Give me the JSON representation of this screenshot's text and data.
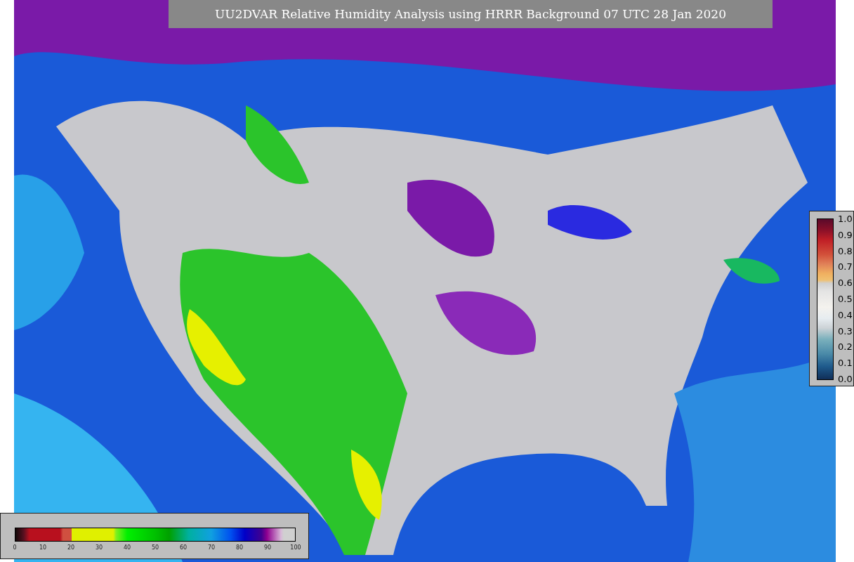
{
  "title": "UU2DVAR Relative Humidity Analysis using HRRR Background 07 UTC 28 Jan 2020",
  "colorbar_bottom": {
    "ticks": [
      "0",
      "10",
      "20",
      "30",
      "40",
      "50",
      "60",
      "70",
      "80",
      "90",
      "100"
    ]
  },
  "colorbar_right": {
    "ticks": [
      "1.0",
      "0.9",
      "0.8",
      "0.7",
      "0.6",
      "0.5",
      "0.4",
      "0.3",
      "0.2",
      "0.1",
      "0.0"
    ]
  }
}
